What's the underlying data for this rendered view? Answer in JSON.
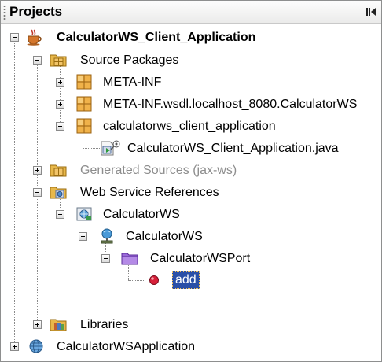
{
  "panel": {
    "title": "Projects",
    "minimize_icon": "minimize-icon"
  },
  "tree": {
    "project": {
      "label": "CalculatorWS_Client_Application",
      "icon": "coffee-cup-icon"
    },
    "source_packages": {
      "label": "Source Packages",
      "icon": "package-folder-icon"
    },
    "pkg_meta_inf": {
      "label": "META-INF",
      "icon": "package-icon"
    },
    "pkg_meta_inf_wsdl": {
      "label": "META-INF.wsdl.localhost_8080.CalculatorWS",
      "icon": "package-icon"
    },
    "pkg_client_app": {
      "label": "calculatorws_client_application",
      "icon": "package-icon"
    },
    "java_file": {
      "label": "CalculatorWS_Client_Application.java",
      "icon": "java-main-class-icon"
    },
    "generated_sources": {
      "label": "Generated Sources (jax-ws)",
      "icon": "package-folder-icon"
    },
    "ws_references": {
      "label": "Web Service References",
      "icon": "ws-references-folder-icon"
    },
    "ws_calculator": {
      "label": "CalculatorWS",
      "icon": "web-service-icon"
    },
    "ws_calculator_service": {
      "label": "CalculatorWS",
      "icon": "service-icon"
    },
    "ws_port": {
      "label": "CalculatorWSPort",
      "icon": "port-folder-icon"
    },
    "ws_operation_add": {
      "label": "add",
      "icon": "operation-icon"
    },
    "libraries": {
      "label": "Libraries",
      "icon": "library-folder-icon"
    },
    "ws_application": {
      "label": "CalculatorWSApplication",
      "icon": "web-application-icon"
    }
  },
  "colors": {
    "selection": "#2a4fa7",
    "folder": "#e8b84a",
    "package": "#e8a33c"
  }
}
